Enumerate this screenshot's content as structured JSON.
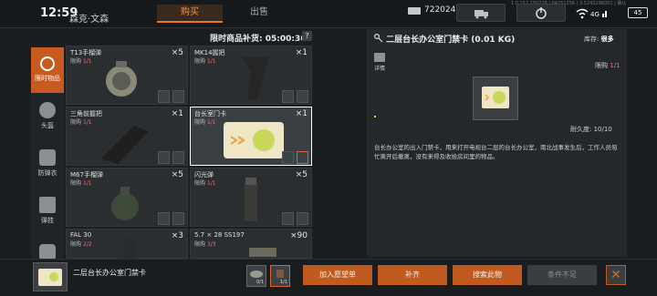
{
  "status": {
    "time": "12:59",
    "player_name": "森克·文森",
    "money": "722024",
    "build_info": "1.0.152.150226 | 04251256 | 3.5242296001 | 确认",
    "signal": "4G",
    "battery": "45"
  },
  "tabs": {
    "buy": "购买",
    "sell": "出售"
  },
  "sidebar": [
    {
      "label": "限时物品"
    },
    {
      "label": "头盔"
    },
    {
      "label": "防弹衣"
    },
    {
      "label": "弹挂"
    },
    {
      "label": ""
    }
  ],
  "countdown": "限时商品补货: 05:00:36",
  "help": "?",
  "items": [
    {
      "name": "T13手榴弹",
      "limit_label": "限购",
      "limit": "1/1",
      "count": "×5"
    },
    {
      "name": "MK14握把",
      "limit_label": "限购",
      "limit": "1/1",
      "count": "×1"
    },
    {
      "name": "三角前握把",
      "limit_label": "限购",
      "limit": "1/1",
      "count": "×1"
    },
    {
      "name": "台长室门卡",
      "limit_label": "限购",
      "limit": "1/1",
      "count": "×1"
    },
    {
      "name": "M67手榴弹",
      "limit_label": "限购",
      "limit": "1/1",
      "count": "×5"
    },
    {
      "name": "闪光弹",
      "limit_label": "限购",
      "limit": "1/1",
      "count": "×5"
    },
    {
      "name": "FAL 30",
      "limit_label": "限购",
      "limit": "2/2",
      "count": "×3"
    },
    {
      "name": "5.7 × 28 SS197",
      "limit_label": "限购",
      "limit": "3/3",
      "count": "×90"
    }
  ],
  "detail": {
    "title": "二层台长办公室门禁卡 (0.01 KG)",
    "stock_label": "库存:",
    "stock_value": "很多",
    "info_label": "详情",
    "limit_label": "限购",
    "limit": "1/1",
    "durability": "耐久度: 10/10",
    "description": "台长办公室的出入门禁卡，用来打开电视台二层的台长办公室，南北战事发生后，工作人员匆忙离开后撤离，没有来得及收拾房间里的物品。"
  },
  "bottom": {
    "name": "二层台长办公室门禁卡",
    "cost1_qty": "0/1",
    "cost2_qty": "1/1",
    "wishlist": "加入愿望单",
    "restock": "补齐",
    "search": "搜索此物",
    "condition": "条件不足",
    "close": "✕"
  },
  "colors": {
    "accent": "#c05a1f",
    "limit_red": "#ff6b6b",
    "panel": "#24282b"
  }
}
